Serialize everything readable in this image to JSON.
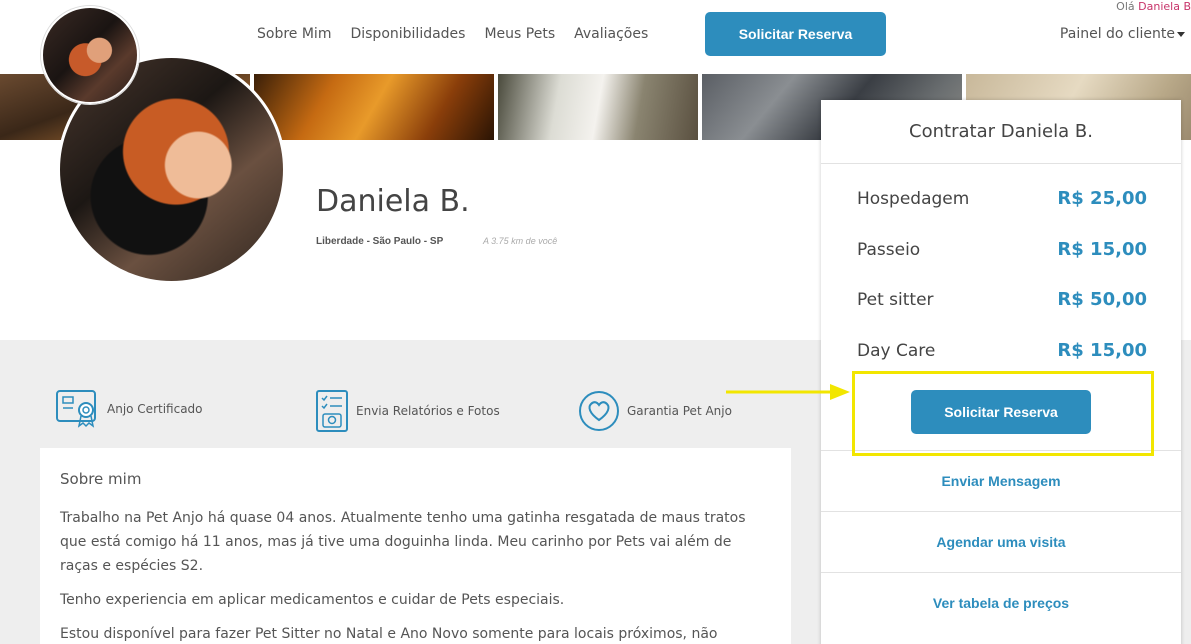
{
  "header": {
    "nav": [
      "Sobre Mim",
      "Disponibilidades",
      "Meus Pets",
      "Avaliações"
    ],
    "cta": "Solicitar Reserva",
    "greeting_prefix": "Olá",
    "greeting_name": "Daniela B",
    "client_panel": "Painel do cliente"
  },
  "profile": {
    "name": "Daniela B.",
    "location": "Liberdade - São Paulo - SP",
    "distance": "A 3.75 km de você"
  },
  "badges": [
    {
      "label": "Anjo Certificado",
      "icon": "certificate-icon"
    },
    {
      "label": "Envia Relatórios e Fotos",
      "icon": "report-icon"
    },
    {
      "label": "Garantia Pet Anjo",
      "icon": "heart-shield-icon"
    }
  ],
  "about": {
    "title": "Sobre mim",
    "paragraphs": [
      "Trabalho na Pet Anjo há quase 04 anos. Atualmente tenho uma gatinha resgatada de maus tratos que está comigo há 11 anos, mas já tive uma doguinha linda. Meu carinho por Pets vai além de raças e espécies S2.",
      "Tenho experiencia em aplicar medicamentos e cuidar de Pets especiais.",
      "Estou disponível para fazer Pet Sitter no Natal e Ano Novo somente para locais próximos, não"
    ]
  },
  "hire_card": {
    "title": "Contratar Daniela B.",
    "services": [
      {
        "name": "Hospedagem",
        "price": "R$ 25,00"
      },
      {
        "name": "Passeio",
        "price": "R$ 15,00"
      },
      {
        "name": "Pet sitter",
        "price": "R$ 50,00"
      },
      {
        "name": "Day Care",
        "price": "R$ 15,00"
      }
    ],
    "request_button": "Solicitar Reserva",
    "links": [
      "Enviar Mensagem",
      "Agendar uma visita",
      "Ver tabela de preços"
    ]
  },
  "colors": {
    "accent": "#2d8dbd",
    "highlight": "#f2e600",
    "username": "#c7346a"
  }
}
